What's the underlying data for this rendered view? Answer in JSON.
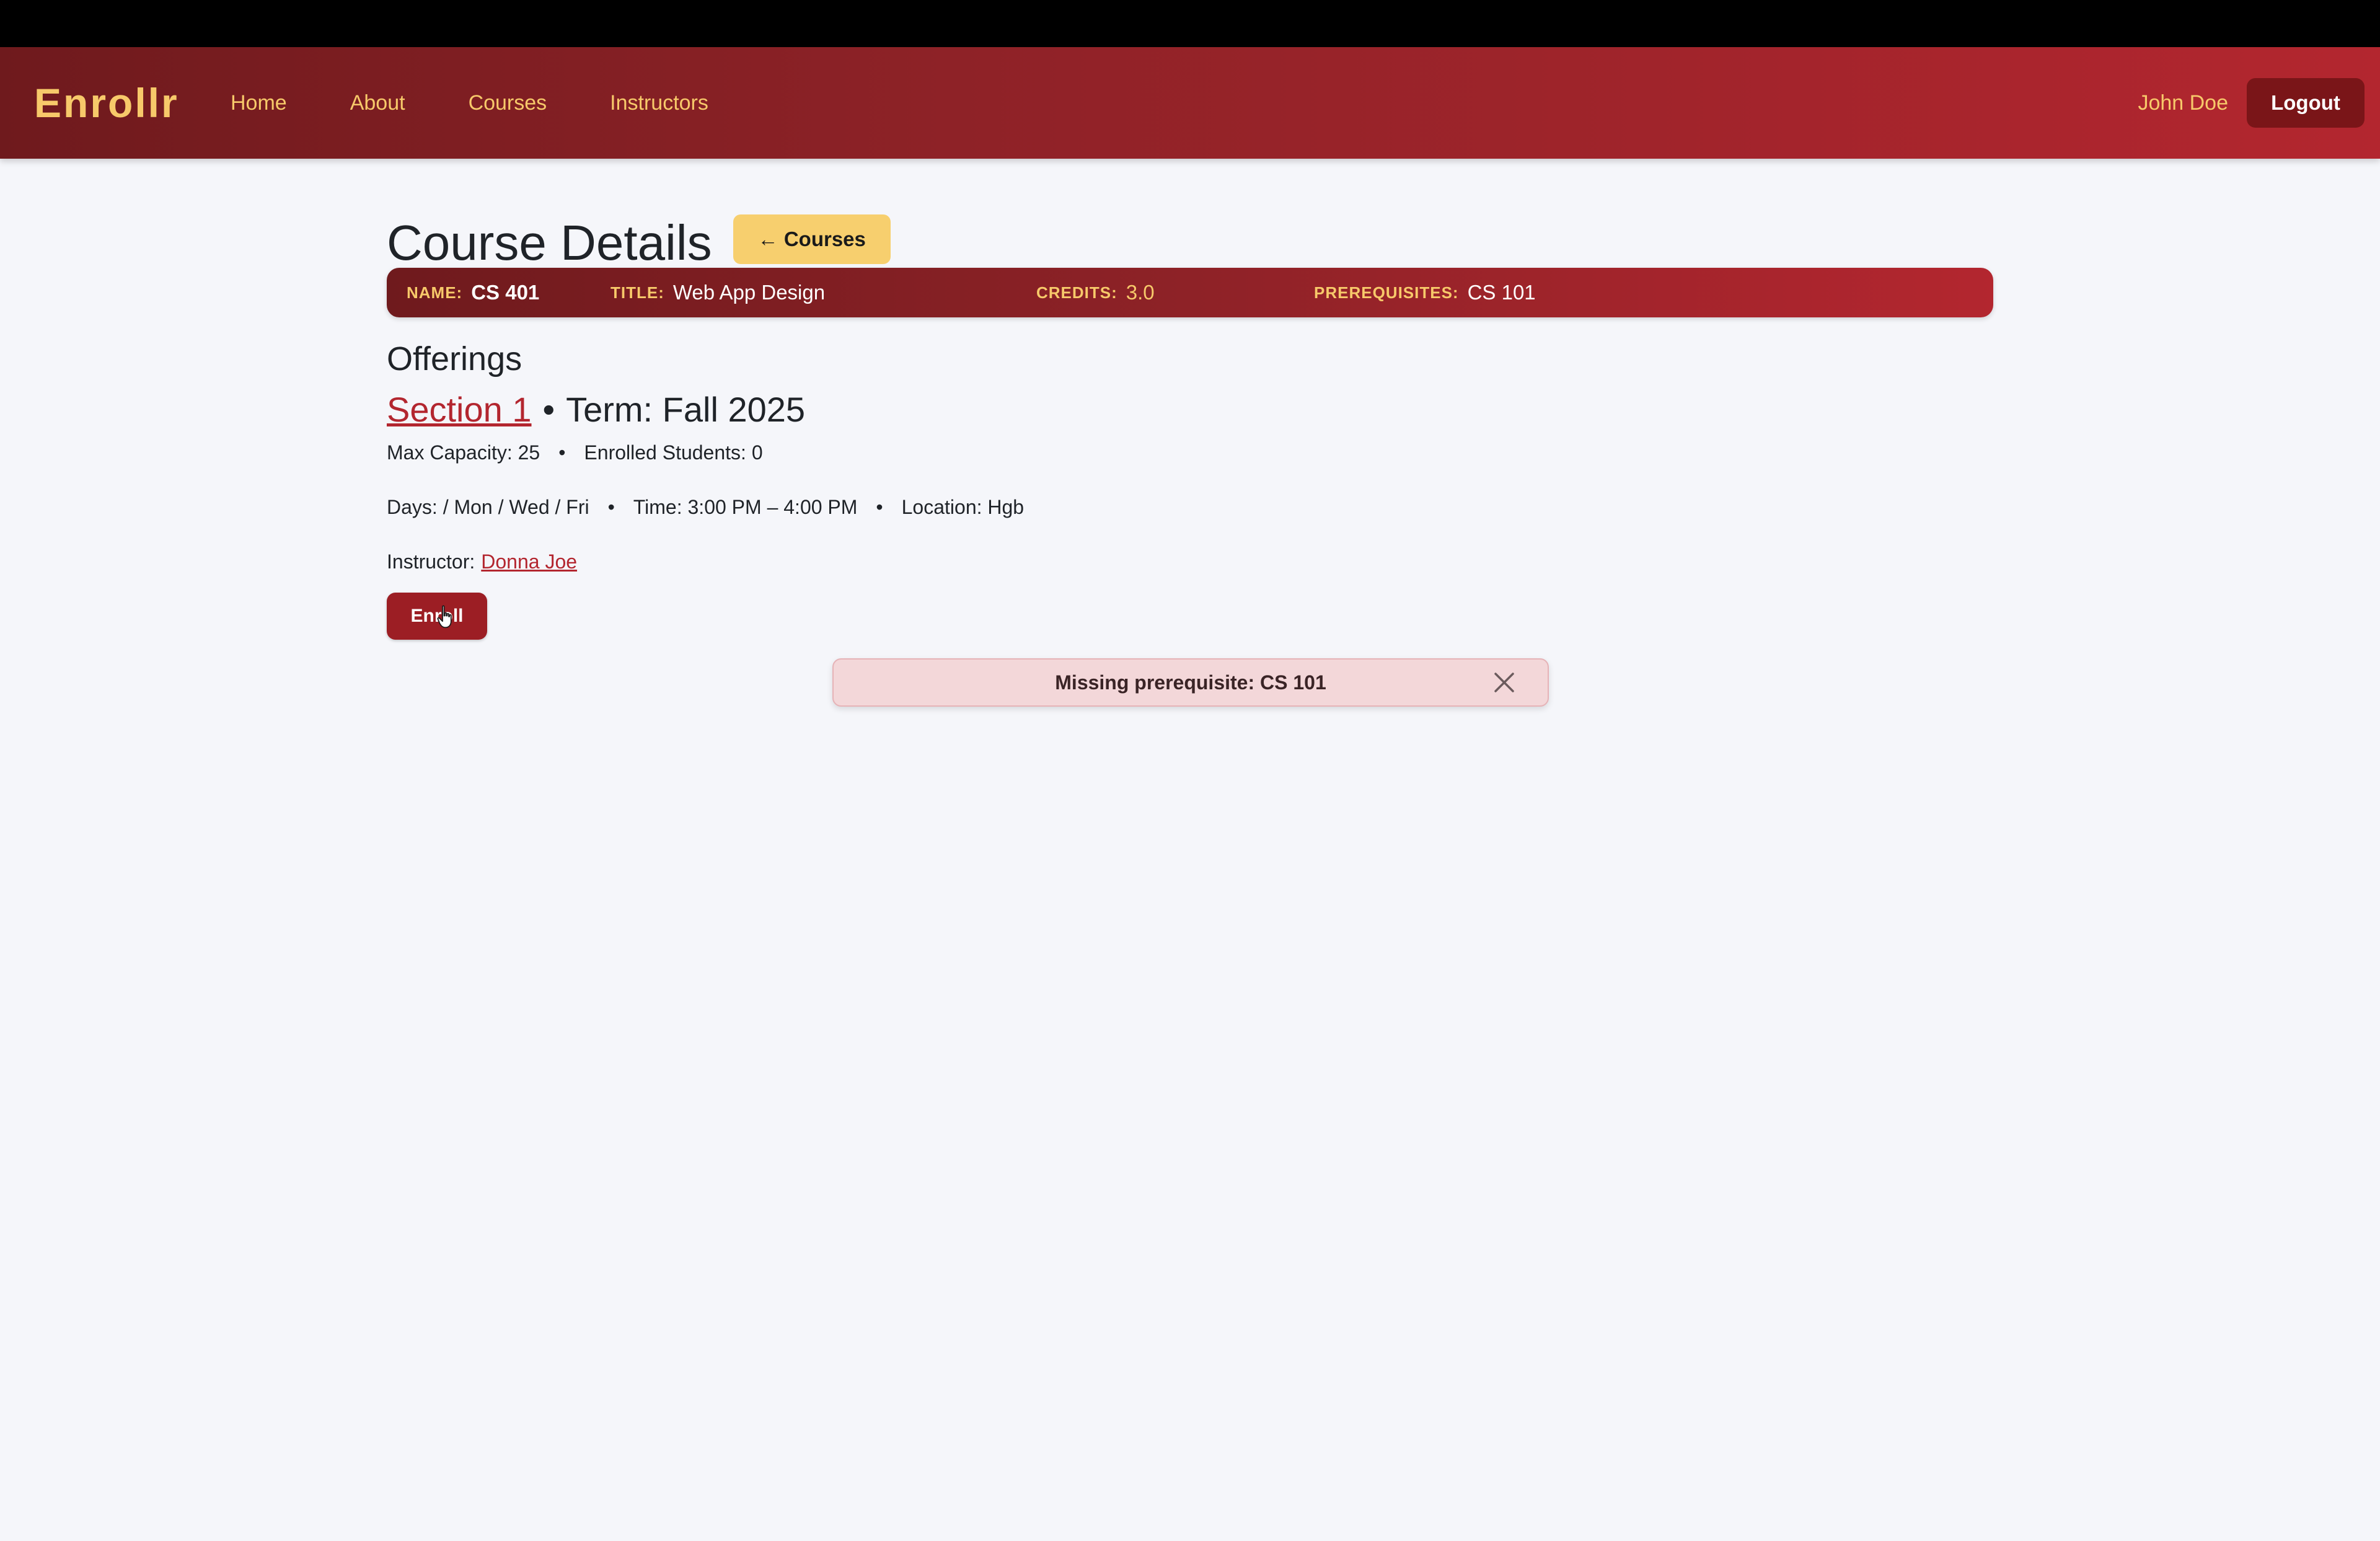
{
  "navbar": {
    "brand": "Enrollr",
    "links": [
      "Home",
      "About",
      "Courses",
      "Instructors"
    ],
    "user_name": "John Doe",
    "logout_label": "Logout"
  },
  "page": {
    "title": "Course Details",
    "back_label": "← Courses"
  },
  "course": {
    "name_label": "NAME:",
    "name": "CS 401",
    "title_label": "TITLE:",
    "title": "Web App Design",
    "credits_label": "CREDITS:",
    "credits": "3.0",
    "prereq_label": "PREREQUISITES:",
    "prereq": "CS 101"
  },
  "offerings": {
    "heading": "Offerings",
    "section_link": "Section 1",
    "separator": "•",
    "term": "Term: Fall 2025",
    "max_capacity": "Max Capacity: 25",
    "enrolled": "Enrolled Students: 0",
    "days": "Days: / Mon / Wed / Fri",
    "time": "Time: 3:00 PM – 4:00 PM",
    "location": "Location: Hgb",
    "instructor_label": "Instructor:",
    "instructor_name": "Donna Joe",
    "bullet": "•",
    "enroll_label": "Enroll"
  },
  "alert": {
    "message": "Missing prerequisite: CS 101"
  },
  "colors": {
    "brand_gold": "#f7c96a",
    "primary_red": "#9c1e24",
    "alert_bg": "#f3d7d9"
  }
}
